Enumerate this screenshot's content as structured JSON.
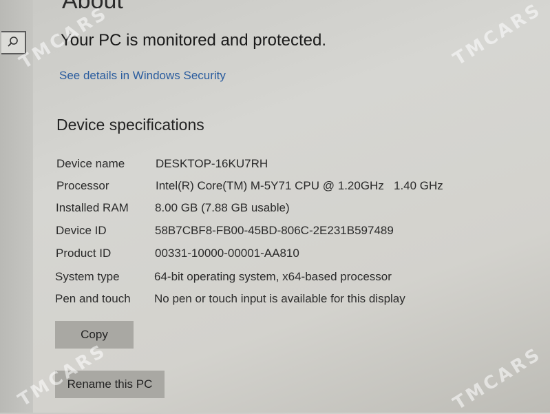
{
  "page": {
    "heading": "About",
    "protection_status": "Your PC is monitored and protected.",
    "security_link": "See details in Windows Security"
  },
  "device_specs": {
    "title": "Device specifications",
    "rows": [
      {
        "label": "Device name",
        "value": "DESKTOP-16KU7RH"
      },
      {
        "label": "Processor",
        "value": "Intel(R) Core(TM) M-5Y71 CPU @ 1.20GHz   1.40 GHz"
      },
      {
        "label": "Installed RAM",
        "value": "8.00 GB (7.88 GB usable)"
      },
      {
        "label": "Device ID",
        "value": "58B7CBF8-FB00-45BD-806C-2E231B597489"
      },
      {
        "label": "Product ID",
        "value": "00331-10000-00001-AA810"
      },
      {
        "label": "System type",
        "value": "64-bit operating system, x64-based processor"
      },
      {
        "label": "Pen and touch",
        "value": "No pen or touch input is available for this display"
      }
    ]
  },
  "buttons": {
    "copy": "Copy",
    "rename": "Rename this PC"
  },
  "watermark": "TMCARS",
  "icons": {
    "search": "search-icon"
  },
  "colors": {
    "link": "#2a5c9e",
    "button_bg": "#a9a8a3"
  }
}
